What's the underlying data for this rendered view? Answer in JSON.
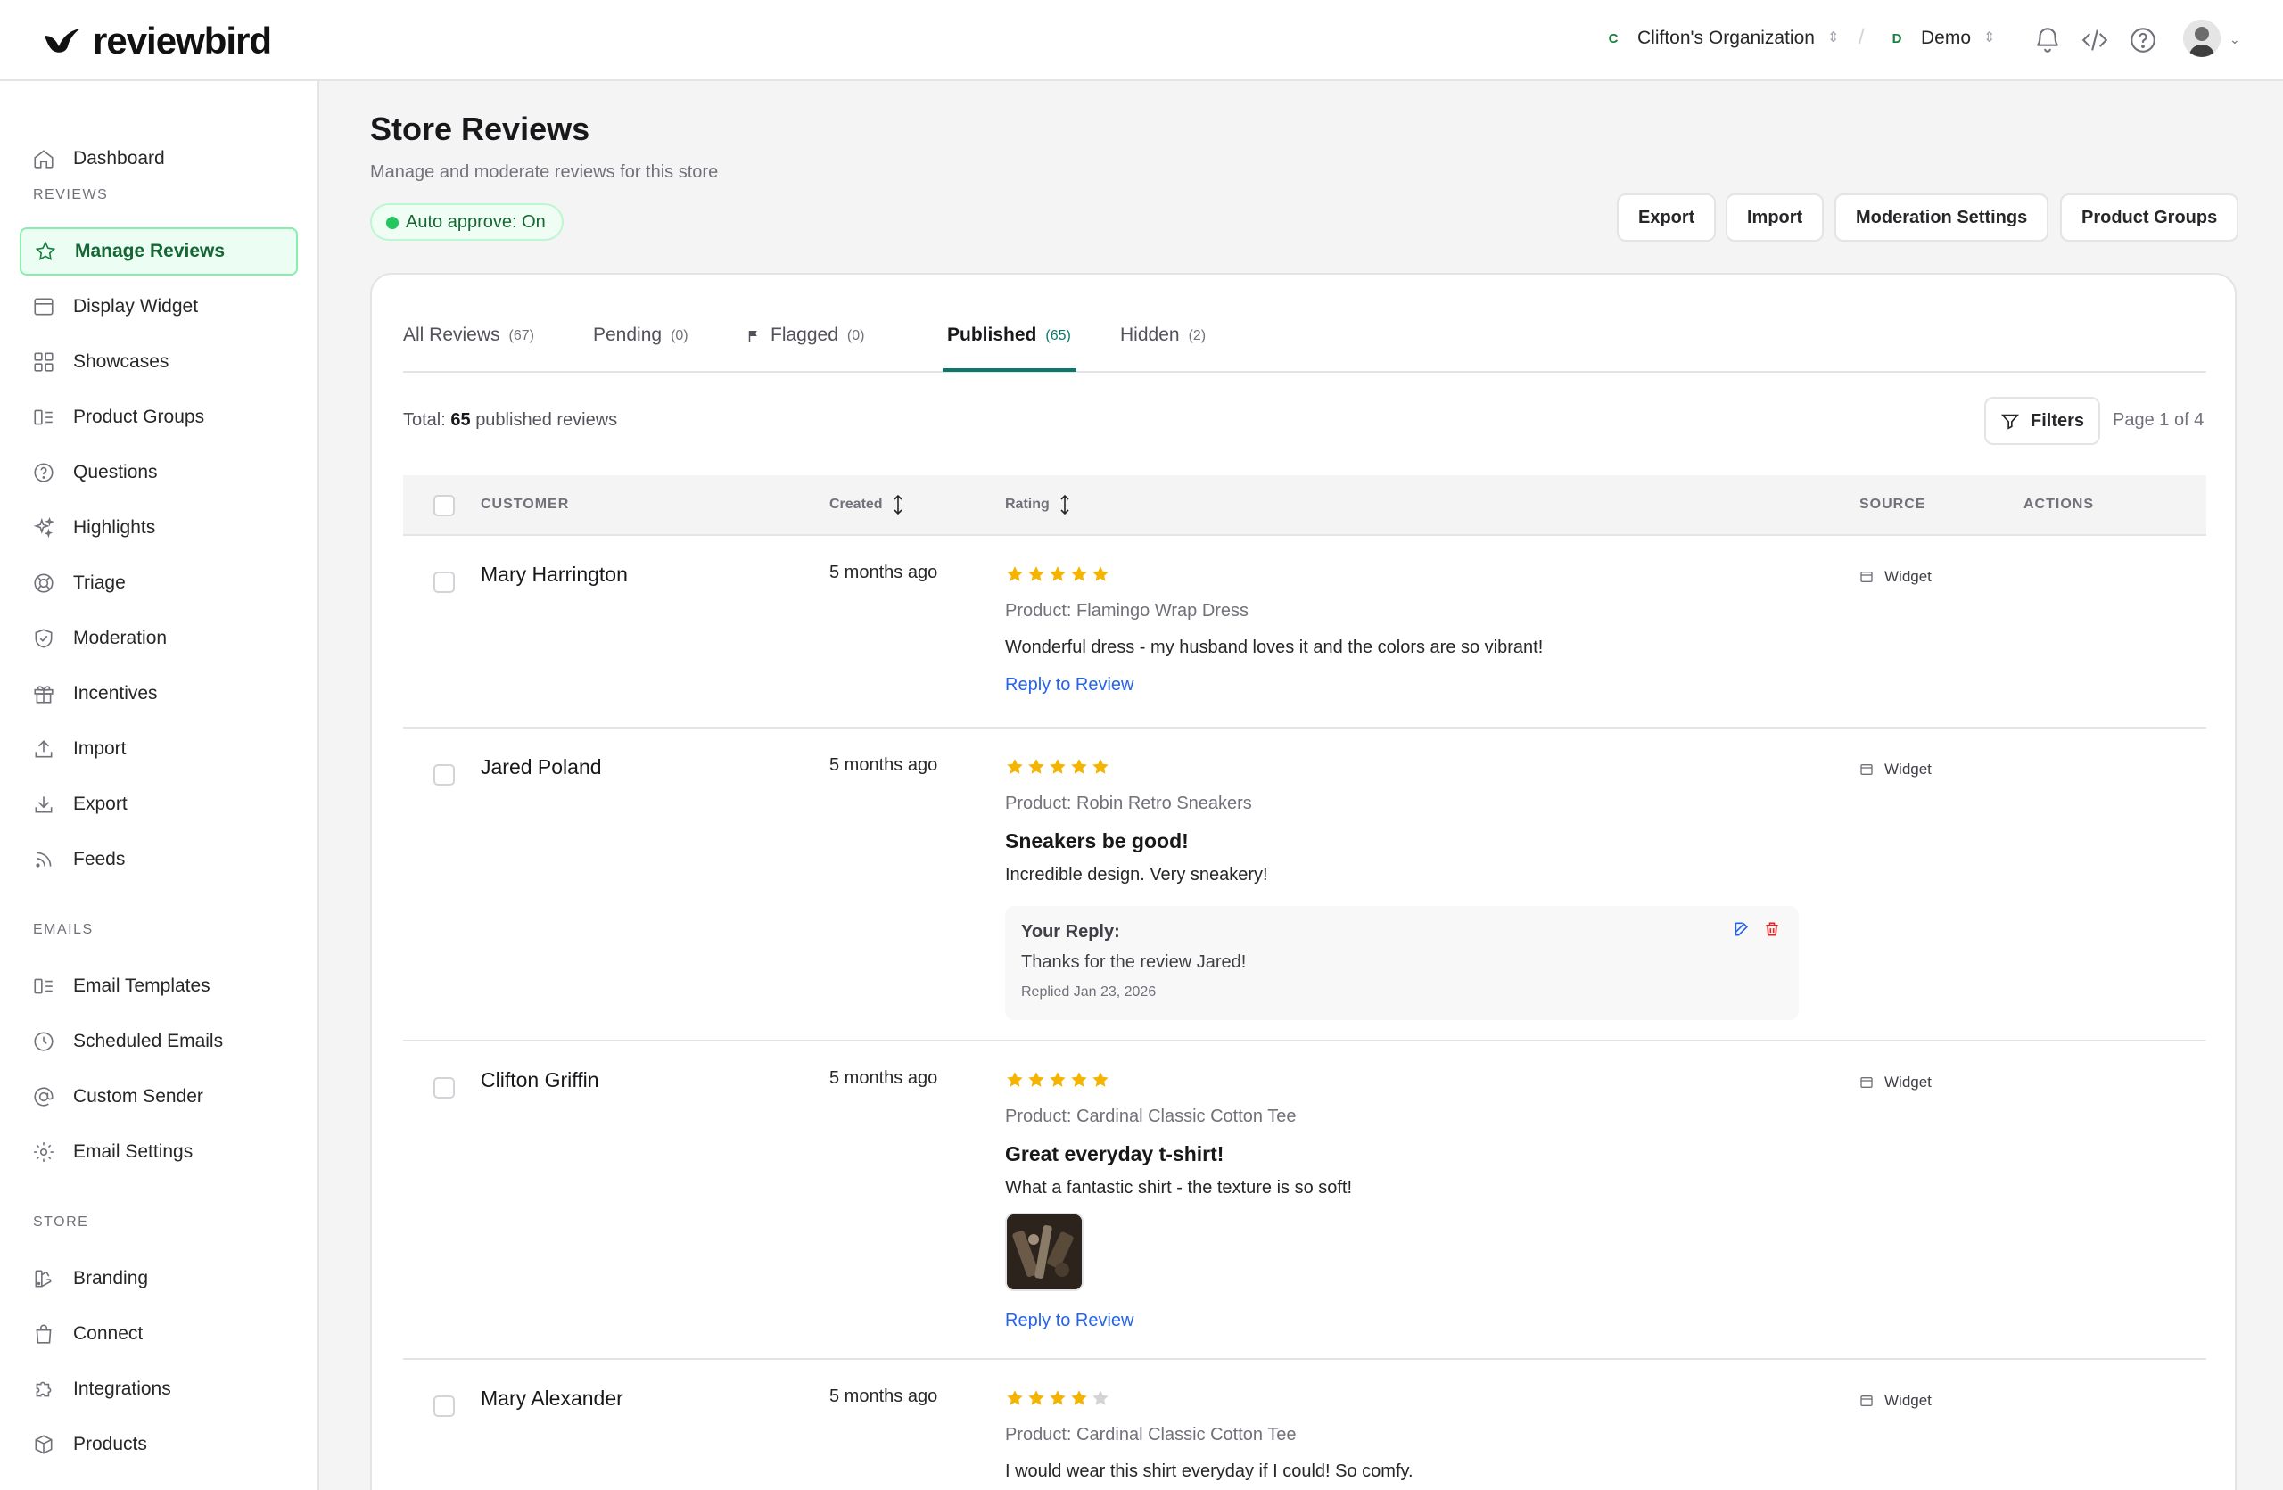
{
  "brand": {
    "name": "reviewbird"
  },
  "topbar": {
    "org": {
      "initial": "C",
      "name": "Clifton's Organization"
    },
    "separator": "/",
    "store": {
      "initial": "D",
      "name": "Demo"
    }
  },
  "sidebar": {
    "top_items": [
      {
        "label": "Dashboard",
        "icon": "home-icon"
      }
    ],
    "sections": [
      {
        "label": "REVIEWS",
        "items": [
          {
            "label": "Manage Reviews",
            "icon": "star-icon",
            "active": true
          },
          {
            "label": "Display Widget",
            "icon": "window-icon"
          },
          {
            "label": "Showcases",
            "icon": "grid-icon"
          },
          {
            "label": "Product Groups",
            "icon": "product-groups-icon"
          },
          {
            "label": "Questions",
            "icon": "question-icon"
          },
          {
            "label": "Highlights",
            "icon": "sparkles-icon"
          },
          {
            "label": "Triage",
            "icon": "lifebuoy-icon"
          },
          {
            "label": "Moderation",
            "icon": "shield-check-icon"
          },
          {
            "label": "Incentives",
            "icon": "gift-icon"
          },
          {
            "label": "Import",
            "icon": "upload-icon"
          },
          {
            "label": "Export",
            "icon": "download-icon"
          },
          {
            "label": "Feeds",
            "icon": "rss-icon"
          }
        ]
      },
      {
        "label": "EMAILS",
        "items": [
          {
            "label": "Email Templates",
            "icon": "template-icon"
          },
          {
            "label": "Scheduled Emails",
            "icon": "clock-icon"
          },
          {
            "label": "Custom Sender",
            "icon": "at-sign-icon"
          },
          {
            "label": "Email Settings",
            "icon": "gear-icon"
          }
        ]
      },
      {
        "label": "STORE",
        "items": [
          {
            "label": "Branding",
            "icon": "palette-icon"
          },
          {
            "label": "Connect",
            "icon": "shopping-bag-icon"
          },
          {
            "label": "Integrations",
            "icon": "puzzle-icon"
          },
          {
            "label": "Products",
            "icon": "box-icon"
          }
        ]
      }
    ]
  },
  "page": {
    "title": "Store Reviews",
    "subtitle": "Manage and moderate reviews for this store",
    "auto_approve": "Auto approve: On",
    "buttons": [
      "Export",
      "Import",
      "Moderation Settings",
      "Product Groups"
    ]
  },
  "tabs": [
    {
      "label": "All Reviews",
      "count": "(67)"
    },
    {
      "label": "Pending",
      "count": "(0)"
    },
    {
      "label": "Flagged",
      "count": "(0)"
    },
    {
      "label": "Published",
      "count": "(65)",
      "active": true
    },
    {
      "label": "Hidden",
      "count": "(2)"
    }
  ],
  "summary": {
    "total_prefix": "Total:",
    "total_count": "65",
    "total_suffix": "published reviews",
    "filters_label": "Filters",
    "page_info": "Page 1 of 4"
  },
  "table": {
    "headers": {
      "customer": "CUSTOMER",
      "created": "Created",
      "rating": "Rating",
      "source": "SOURCE",
      "actions": "ACTIONS"
    },
    "reply_link_label": "Reply to Review",
    "reply_heading": "Your Reply:",
    "rows": [
      {
        "customer": "Mary Harrington",
        "created": "5 months ago",
        "rating": 5,
        "product": "Product: Flamingo Wrap Dress",
        "title": "",
        "body": "Wonderful dress - my husband loves it and the colors are so vibrant!",
        "source": "Widget"
      },
      {
        "customer": "Jared Poland",
        "created": "5 months ago",
        "rating": 5,
        "product": "Product: Robin Retro Sneakers",
        "title": "Sneakers be good!",
        "body": "Incredible design. Very sneakery!",
        "reply": {
          "text": "Thanks for the review Jared!",
          "date": "Replied Jan 23, 2026"
        },
        "source": "Widget"
      },
      {
        "customer": "Clifton Griffin",
        "created": "5 months ago",
        "rating": 5,
        "product": "Product: Cardinal Classic Cotton Tee",
        "title": "Great everyday t-shirt!",
        "body": "What a fantastic shirt - the texture is so soft!",
        "has_photo": true,
        "source": "Widget"
      },
      {
        "customer": "Mary Alexander",
        "created": "5 months ago",
        "rating": 4,
        "product": "Product: Cardinal Classic Cotton Tee",
        "title": "",
        "body": "I would wear this shirt everyday if I could! So comfy.",
        "source": "Widget"
      }
    ]
  },
  "colors": {
    "accent": "#0f766e",
    "star": "#f5b400",
    "star_empty": "#d4d4d8",
    "link": "#2563eb",
    "danger": "#dc2626"
  }
}
